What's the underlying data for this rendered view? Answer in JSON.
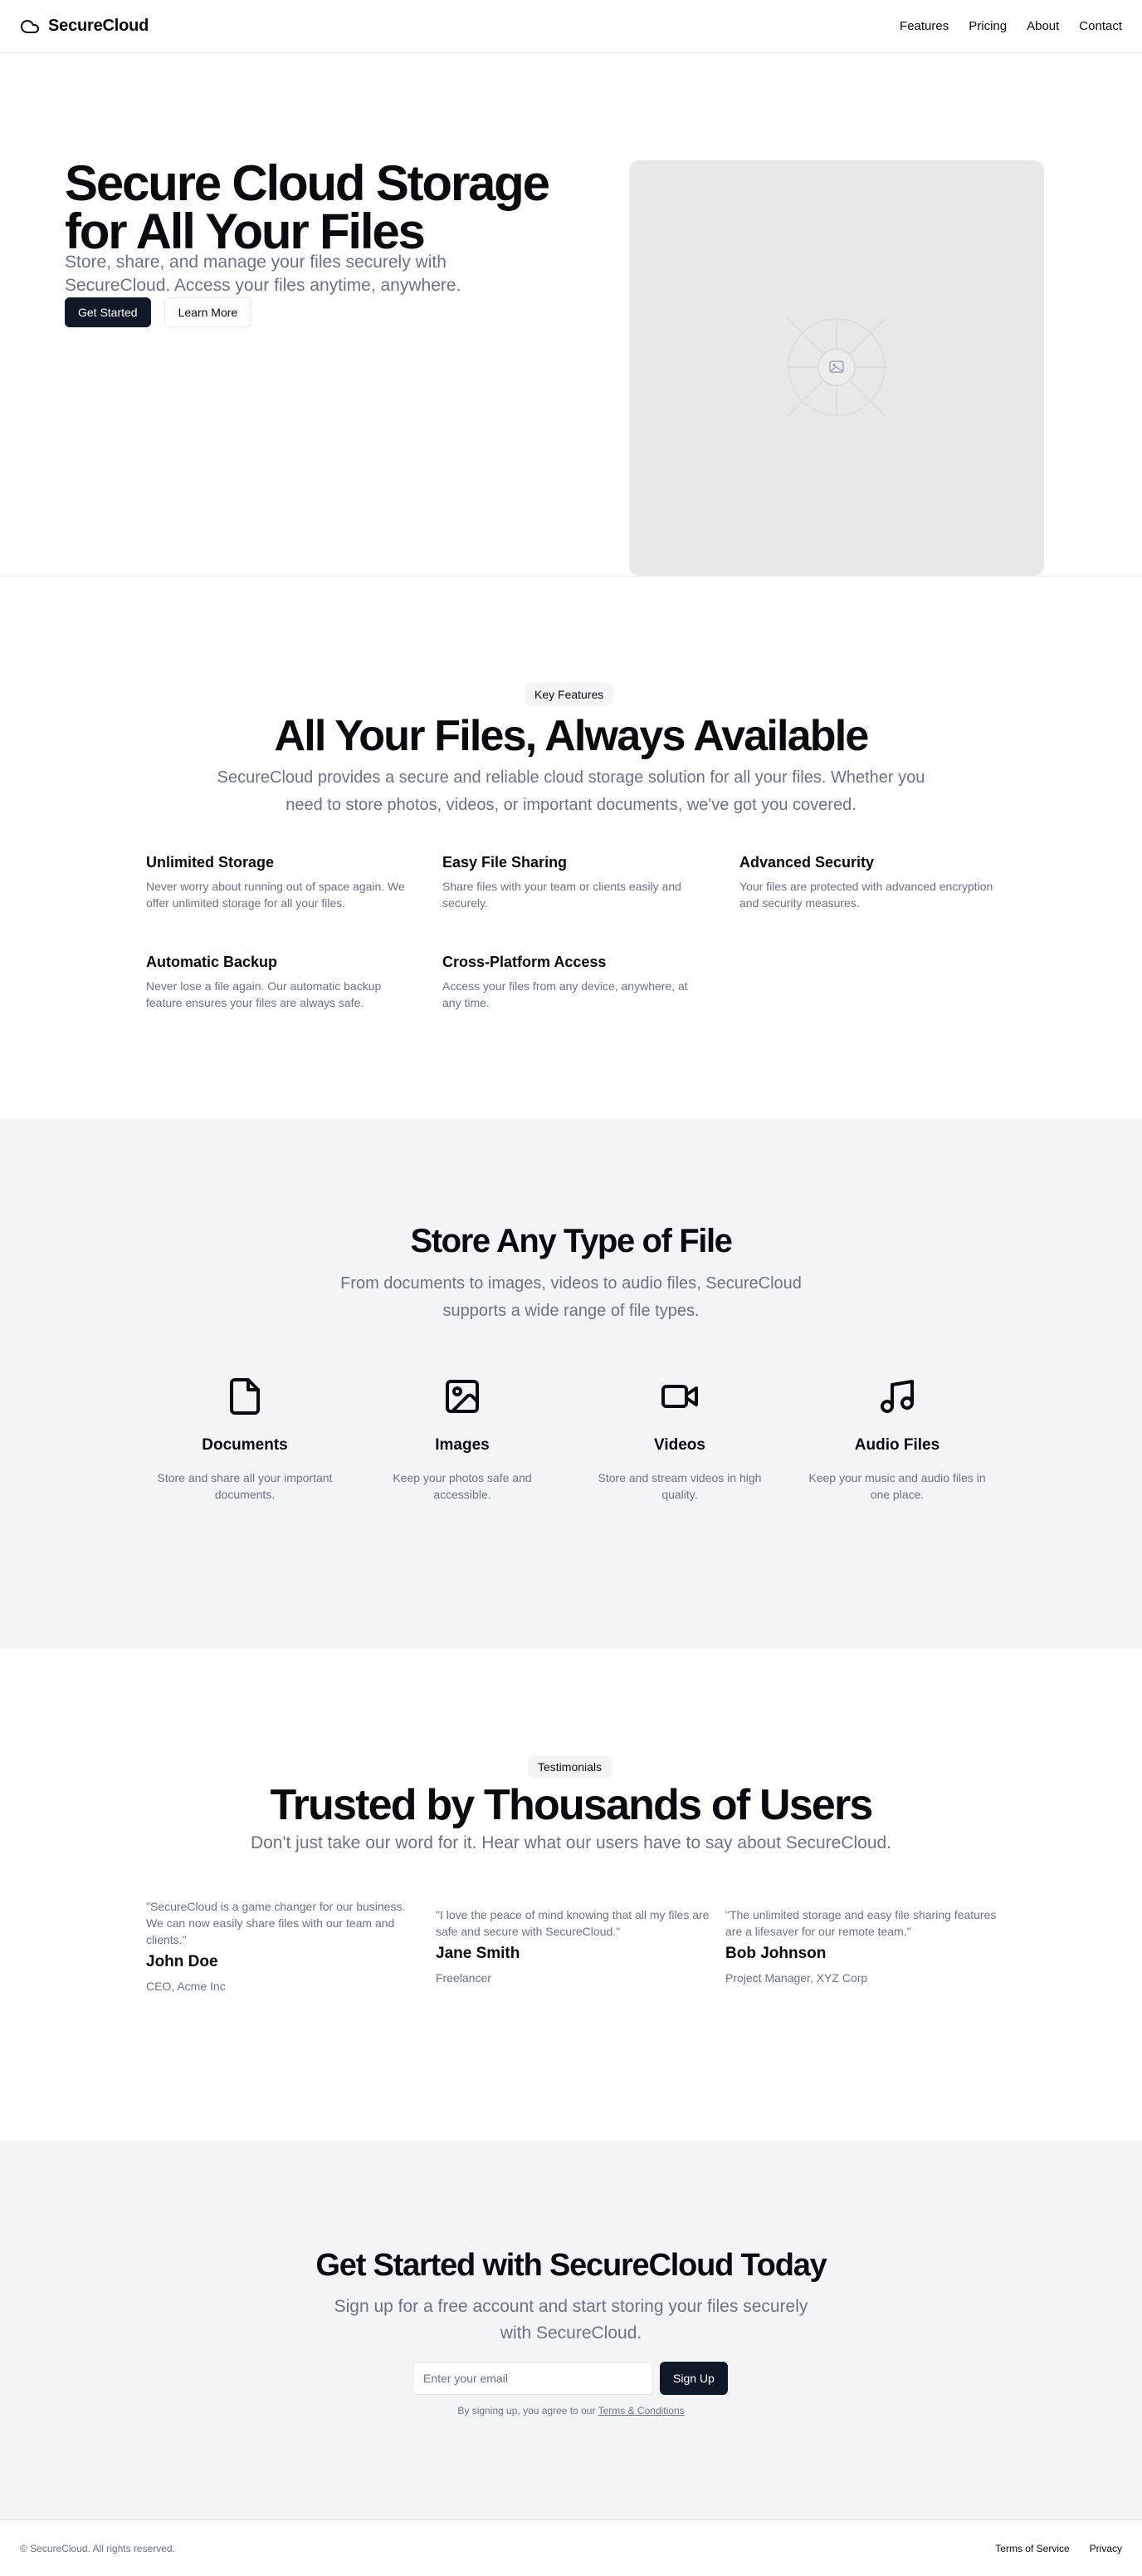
{
  "header": {
    "brand": "SecureCloud",
    "brand_icon": "cloud-icon",
    "nav": [
      "Features",
      "Pricing",
      "About",
      "Contact"
    ]
  },
  "hero": {
    "title": "Secure Cloud Storage for All Your Files",
    "subtitle": "Store, share, and manage your files securely with SecureCloud. Access your files anytime, anywhere.",
    "primary_button": "Get Started",
    "secondary_button": "Learn More",
    "image_icon": "image-placeholder-icon"
  },
  "features": {
    "badge": "Key Features",
    "title": "All Your Files, Always Available",
    "subtitle": "SecureCloud provides a secure and reliable cloud storage solution for all your files. Whether you need to store photos, videos, or important documents, we've got you covered.",
    "items": [
      {
        "title": "Unlimited Storage",
        "desc": "Never worry about running out of space again. We offer unlimited storage for all your files."
      },
      {
        "title": "Easy File Sharing",
        "desc": "Share files with your team or clients easily and securely."
      },
      {
        "title": "Advanced Security",
        "desc": "Your files are protected with advanced encryption and security measures."
      },
      {
        "title": "Automatic Backup",
        "desc": "Never lose a file again. Our automatic backup feature ensures your files are always safe."
      },
      {
        "title": "Cross-Platform Access",
        "desc": "Access your files from any device, anywhere, at any time."
      }
    ]
  },
  "filetypes": {
    "title": "Store Any Type of File",
    "subtitle": "From documents to images, videos to audio files, SecureCloud supports a wide range of file types.",
    "items": [
      {
        "icon": "document-icon",
        "title": "Documents",
        "desc": "Store and share all your important documents."
      },
      {
        "icon": "image-icon",
        "title": "Images",
        "desc": "Keep your photos safe and accessible."
      },
      {
        "icon": "video-icon",
        "title": "Videos",
        "desc": "Store and stream videos in high quality."
      },
      {
        "icon": "music-icon",
        "title": "Audio Files",
        "desc": "Keep your music and audio files in one place."
      }
    ]
  },
  "testimonials": {
    "badge": "Testimonials",
    "title": "Trusted by Thousands of Users",
    "subtitle": "Don't just take our word for it. Hear what our users have to say about SecureCloud.",
    "items": [
      {
        "quote": "\"SecureCloud is a game changer for our business. We can now easily share files with our team and clients.\"",
        "name": "John Doe",
        "role": "CEO, Acme Inc"
      },
      {
        "quote": "\"I love the peace of mind knowing that all my files are safe and secure with SecureCloud.\"",
        "name": "Jane Smith",
        "role": "Freelancer"
      },
      {
        "quote": "\"The unlimited storage and easy file sharing features are a lifesaver for our remote team.\"",
        "name": "Bob Johnson",
        "role": "Project Manager, XYZ Corp"
      }
    ]
  },
  "cta": {
    "title": "Get Started with SecureCloud Today",
    "subtitle": "Sign up for a free account and start storing your files securely with SecureCloud.",
    "email_placeholder": "Enter your email",
    "button": "Sign Up",
    "note_prefix": "By signing up, you agree to our ",
    "note_link": "Terms & Conditions"
  },
  "footer": {
    "copyright": "© SecureCloud. All rights reserved.",
    "links": [
      "Terms of Service",
      "Privacy"
    ]
  }
}
